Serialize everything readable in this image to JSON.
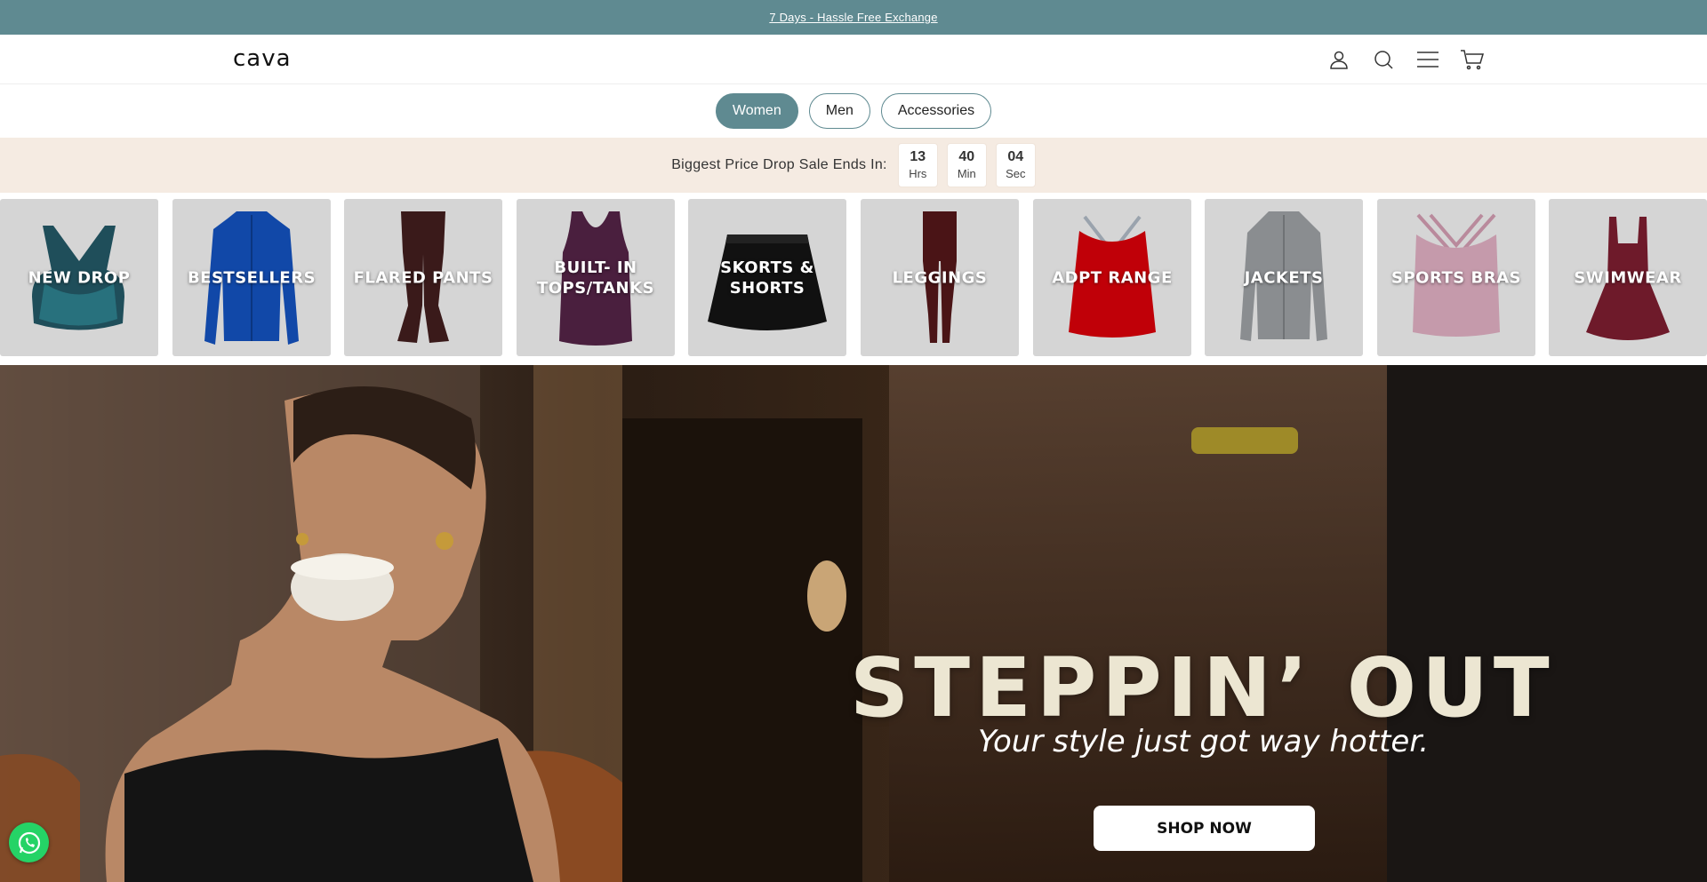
{
  "announcement": {
    "text": "7 Days - Hassle Free Exchange"
  },
  "header": {
    "logo": "cava",
    "icons": [
      "account-icon",
      "search-icon",
      "menu-icon",
      "cart-icon"
    ]
  },
  "tabs": [
    {
      "label": "Women",
      "active": true
    },
    {
      "label": "Men",
      "active": false
    },
    {
      "label": "Accessories",
      "active": false
    }
  ],
  "countdown": {
    "label": "Biggest Price Drop Sale Ends In:",
    "hours": "13",
    "hours_unit": "Hrs",
    "minutes": "40",
    "minutes_unit": "Min",
    "seconds": "04",
    "seconds_unit": "Sec"
  },
  "categories": [
    {
      "label": "NEW DROP"
    },
    {
      "label": "BESTSELLERS"
    },
    {
      "label": "FLARED PANTS"
    },
    {
      "label": "BUILT- IN TOPS/TANKS"
    },
    {
      "label": "SKORTS & SHORTS"
    },
    {
      "label": "LEGGINGS"
    },
    {
      "label": "ADPT RANGE"
    },
    {
      "label": "JACKETS"
    },
    {
      "label": "SPORTS BRAS"
    },
    {
      "label": "SWIMWEAR"
    }
  ],
  "hero": {
    "title": "STEPPIN’ OUT",
    "subtitle": "Your style just got way hotter.",
    "cta": "SHOP NOW"
  },
  "colors": {
    "accent": "#5f8a91",
    "countdown_bg": "#f5ebe2",
    "whatsapp": "#25d366"
  }
}
